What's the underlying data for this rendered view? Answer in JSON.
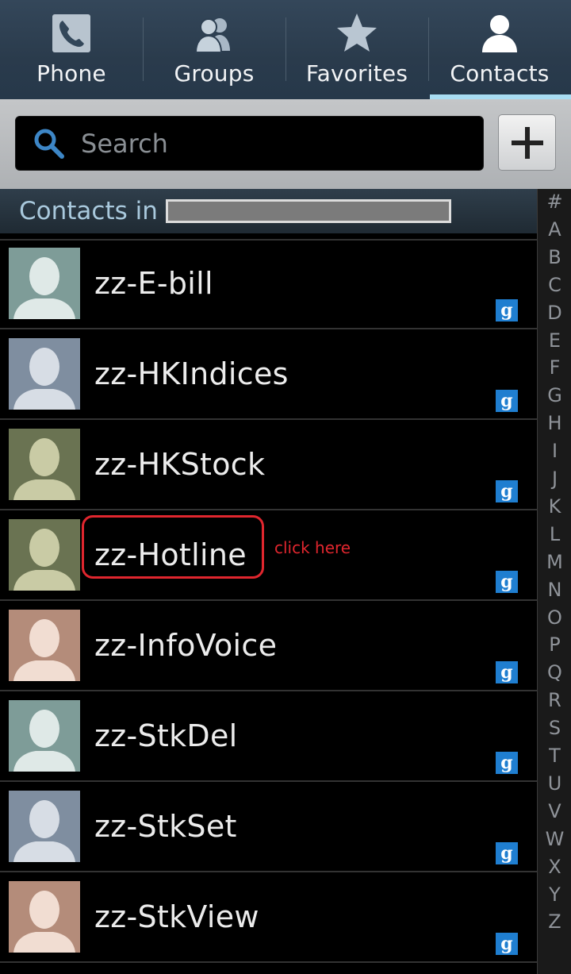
{
  "tabs": [
    {
      "label": "Phone",
      "icon": "phone-icon",
      "active": false
    },
    {
      "label": "Groups",
      "icon": "groups-icon",
      "active": false
    },
    {
      "label": "Favorites",
      "icon": "star-icon",
      "active": false
    },
    {
      "label": "Contacts",
      "icon": "contact-person-icon",
      "active": true
    }
  ],
  "search": {
    "placeholder": "Search"
  },
  "section_header": {
    "label": "Contacts in"
  },
  "contacts": [
    {
      "name": "zz-E-bill",
      "avatar_color": "#7e9c98",
      "account_badge": "g"
    },
    {
      "name": "zz-HKIndices",
      "avatar_color": "#7f8ea0",
      "account_badge": "g"
    },
    {
      "name": "zz-HKStock",
      "avatar_color": "#6a7352",
      "account_badge": "g"
    },
    {
      "name": "zz-Hotline",
      "avatar_color": "#6a7352",
      "account_badge": "g"
    },
    {
      "name": "zz-InfoVoice",
      "avatar_color": "#b48c7a",
      "account_badge": "g"
    },
    {
      "name": "zz-StkDel",
      "avatar_color": "#7e9c98",
      "account_badge": "g"
    },
    {
      "name": "zz-StkSet",
      "avatar_color": "#7f8ea0",
      "account_badge": "g"
    },
    {
      "name": "zz-StkView",
      "avatar_color": "#b48c7a",
      "account_badge": "g"
    }
  ],
  "annotation": {
    "text": "click here",
    "color": "#e0262e"
  },
  "index_letters": [
    "#",
    "A",
    "B",
    "C",
    "D",
    "E",
    "F",
    "G",
    "H",
    "I",
    "J",
    "K",
    "L",
    "M",
    "N",
    "O",
    "P",
    "Q",
    "R",
    "S",
    "T",
    "U",
    "V",
    "W",
    "X",
    "Y",
    "Z"
  ],
  "colors": {
    "active_tab_indicator": "#a8dcf2",
    "google_badge": "#1f7ed0"
  }
}
